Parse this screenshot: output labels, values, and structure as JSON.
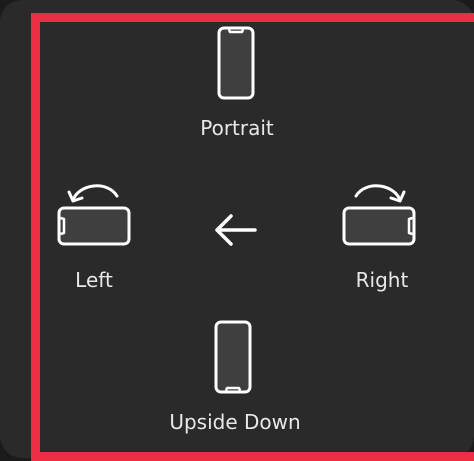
{
  "orientation_menu": {
    "options": {
      "portrait": {
        "label": "Portrait",
        "icon": "phone-portrait-icon"
      },
      "left": {
        "label": "Left",
        "icon": "phone-landscape-left-icon"
      },
      "right": {
        "label": "Right",
        "icon": "phone-landscape-right-icon"
      },
      "upside_down": {
        "label": "Upside Down",
        "icon": "phone-upside-down-icon"
      }
    },
    "back": {
      "icon": "back-arrow-icon"
    }
  },
  "colors": {
    "panel_background": "#2a2a2a",
    "icon_stroke": "#ffffff",
    "label_text": "#e8e8e8",
    "highlight_border": "#ec2d46"
  }
}
